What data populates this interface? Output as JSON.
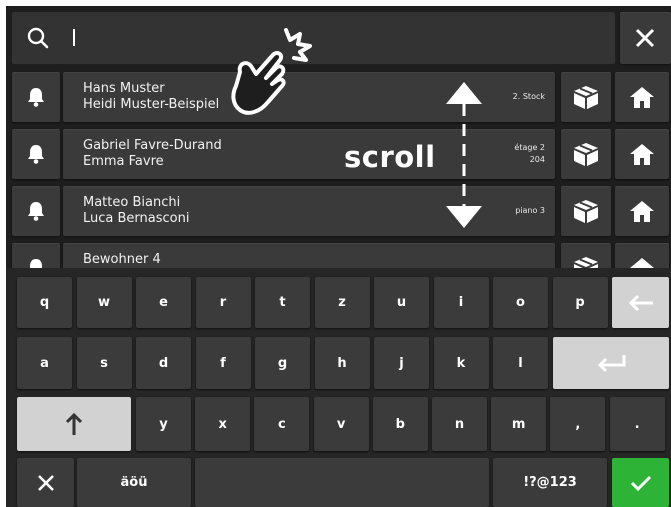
{
  "search": {
    "placeholder": "",
    "value": "",
    "search_icon": "search-icon",
    "close_icon": "close-icon"
  },
  "residents": [
    {
      "name1": "Hans Muster",
      "name2": "Heidi Muster-Beispiel",
      "loc1": "2. Stock",
      "loc2": ""
    },
    {
      "name1": "Gabriel Favre-Durand",
      "name2": "Emma Favre",
      "loc1": "étage 2",
      "loc2": "204"
    },
    {
      "name1": "Matteo Bianchi",
      "name2": "Luca Bernasconi",
      "loc1": "piano 3",
      "loc2": ""
    },
    {
      "name1": "Bewohner 4",
      "name2": "",
      "loc1": "",
      "loc2": ""
    }
  ],
  "row_icons": {
    "bell": "bell-icon",
    "package": "package-icon",
    "home": "home-icon"
  },
  "overlay": {
    "scroll_label": "scroll",
    "gesture_icon": "tap-hand-icon"
  },
  "keyboard": {
    "row1": [
      "q",
      "w",
      "e",
      "r",
      "t",
      "z",
      "u",
      "i",
      "o",
      "p"
    ],
    "row2": [
      "a",
      "s",
      "d",
      "f",
      "g",
      "h",
      "j",
      "k",
      "l"
    ],
    "row3": [
      "y",
      "x",
      "c",
      "v",
      "b",
      "n",
      "m",
      ",",
      "."
    ],
    "umlaut_label": "äöü",
    "symbols_label": "!?@123"
  },
  "colors": {
    "screen_bg": "#1e1e1e",
    "tile": "#3a3a3a",
    "confirm": "#2db336",
    "special_key": "#d2d2d2"
  }
}
